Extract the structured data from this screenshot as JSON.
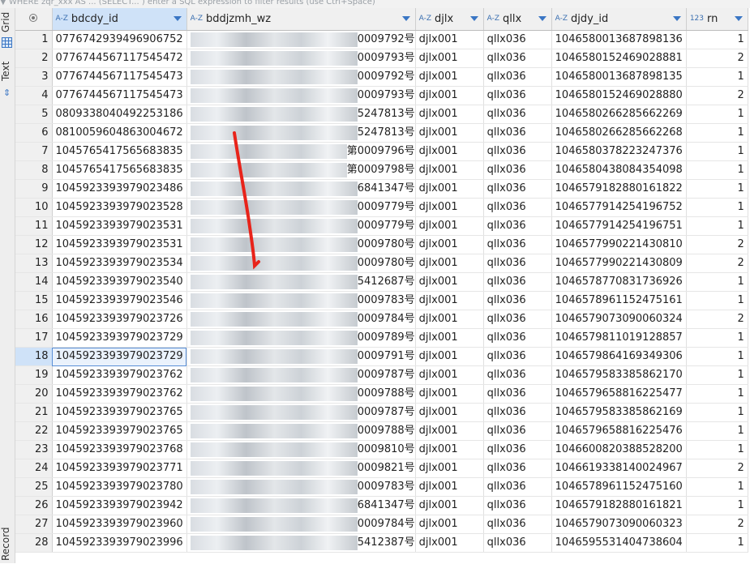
{
  "topbar": {
    "text": "▼ WHERE  zqr_xxx AS ... (SELECT... ) enter a SQL expression to filter results (use Ctrl+Space)"
  },
  "sidebar": {
    "tabs": [
      {
        "label": "Grid"
      },
      {
        "label": "Text"
      },
      {
        "label": "Record"
      }
    ]
  },
  "columns": [
    {
      "name": "bdcdy_id",
      "type_icon": "A-Z"
    },
    {
      "name": "bddjzmh_wz",
      "type_icon": "A-Z"
    },
    {
      "name": "djlx",
      "type_icon": "A-Z"
    },
    {
      "name": "qllx",
      "type_icon": "A-Z"
    },
    {
      "name": "djdy_id",
      "type_icon": "A-Z"
    },
    {
      "name": "rn",
      "type_icon": "123"
    }
  ],
  "rows": [
    {
      "n": "1",
      "bdcdy_id": "0776742939496906752",
      "wz": "0009792号",
      "djlx": "djlx001",
      "qllx": "qllx036",
      "djdy_id": "1046580013687898136",
      "rn": "1"
    },
    {
      "n": "2",
      "bdcdy_id": "0776744567117545472",
      "wz": "0009793号",
      "djlx": "djlx001",
      "qllx": "qllx036",
      "djdy_id": "1046580152469028881",
      "rn": "2"
    },
    {
      "n": "3",
      "bdcdy_id": "0776744567117545473",
      "wz": "0009792号",
      "djlx": "djlx001",
      "qllx": "qllx036",
      "djdy_id": "1046580013687898135",
      "rn": "1"
    },
    {
      "n": "4",
      "bdcdy_id": "0776744567117545473",
      "wz": "0009793号",
      "djlx": "djlx001",
      "qllx": "qllx036",
      "djdy_id": "1046580152469028880",
      "rn": "2"
    },
    {
      "n": "5",
      "bdcdy_id": "0809338040492253186",
      "wz": "5247813号",
      "djlx": "djlx001",
      "qllx": "qllx036",
      "djdy_id": "1046580266285662269",
      "rn": "1"
    },
    {
      "n": "6",
      "bdcdy_id": "0810059604863004672",
      "wz": "5247813号",
      "djlx": "djlx001",
      "qllx": "qllx036",
      "djdy_id": "1046580266285662268",
      "rn": "1"
    },
    {
      "n": "7",
      "bdcdy_id": "1045765417565683835",
      "wz": "第0009796号",
      "djlx": "djlx001",
      "qllx": "qllx036",
      "djdy_id": "1046580378223247376",
      "rn": "1"
    },
    {
      "n": "8",
      "bdcdy_id": "1045765417565683835",
      "wz": "第0009798号",
      "djlx": "djlx001",
      "qllx": "qllx036",
      "djdy_id": "1046580438084354098",
      "rn": "1"
    },
    {
      "n": "9",
      "bdcdy_id": "1045923393979023486",
      "wz": "6841347号",
      "djlx": "djlx001",
      "qllx": "qllx036",
      "djdy_id": "1046579182880161822",
      "rn": "1"
    },
    {
      "n": "10",
      "bdcdy_id": "1045923393979023528",
      "wz": "0009779号",
      "djlx": "djlx001",
      "qllx": "qllx036",
      "djdy_id": "1046577914254196752",
      "rn": "1"
    },
    {
      "n": "11",
      "bdcdy_id": "1045923393979023531",
      "wz": "0009779号",
      "djlx": "djlx001",
      "qllx": "qllx036",
      "djdy_id": "1046577914254196751",
      "rn": "1"
    },
    {
      "n": "12",
      "bdcdy_id": "1045923393979023531",
      "wz": "0009780号",
      "djlx": "djlx001",
      "qllx": "qllx036",
      "djdy_id": "1046577990221430810",
      "rn": "2"
    },
    {
      "n": "13",
      "bdcdy_id": "1045923393979023534",
      "wz": "0009780号",
      "djlx": "djlx001",
      "qllx": "qllx036",
      "djdy_id": "1046577990221430809",
      "rn": "2"
    },
    {
      "n": "14",
      "bdcdy_id": "1045923393979023540",
      "wz": "5412687号",
      "djlx": "djlx001",
      "qllx": "qllx036",
      "djdy_id": "1046578770831736926",
      "rn": "1"
    },
    {
      "n": "15",
      "bdcdy_id": "1045923393979023546",
      "wz": "0009783号",
      "djlx": "djlx001",
      "qllx": "qllx036",
      "djdy_id": "1046578961152475161",
      "rn": "1"
    },
    {
      "n": "16",
      "bdcdy_id": "1045923393979023726",
      "wz": "0009784号",
      "djlx": "djlx001",
      "qllx": "qllx036",
      "djdy_id": "1046579073090060324",
      "rn": "2"
    },
    {
      "n": "17",
      "bdcdy_id": "1045923393979023729",
      "wz": "0009789号",
      "djlx": "djlx001",
      "qllx": "qllx036",
      "djdy_id": "1046579811019128857",
      "rn": "1"
    },
    {
      "n": "18",
      "bdcdy_id": "1045923393979023729",
      "wz": "0009791号",
      "djlx": "djlx001",
      "qllx": "qllx036",
      "djdy_id": "1046579864169349306",
      "rn": "1"
    },
    {
      "n": "19",
      "bdcdy_id": "1045923393979023762",
      "wz": "0009787号",
      "djlx": "djlx001",
      "qllx": "qllx036",
      "djdy_id": "1046579583385862170",
      "rn": "1"
    },
    {
      "n": "20",
      "bdcdy_id": "1045923393979023762",
      "wz": "0009788号",
      "djlx": "djlx001",
      "qllx": "qllx036",
      "djdy_id": "1046579658816225477",
      "rn": "1"
    },
    {
      "n": "21",
      "bdcdy_id": "1045923393979023765",
      "wz": "0009787号",
      "djlx": "djlx001",
      "qllx": "qllx036",
      "djdy_id": "1046579583385862169",
      "rn": "1"
    },
    {
      "n": "22",
      "bdcdy_id": "1045923393979023765",
      "wz": "0009788号",
      "djlx": "djlx001",
      "qllx": "qllx036",
      "djdy_id": "1046579658816225476",
      "rn": "1"
    },
    {
      "n": "23",
      "bdcdy_id": "1045923393979023768",
      "wz": "0009810号",
      "djlx": "djlx001",
      "qllx": "qllx036",
      "djdy_id": "1046600820388528200",
      "rn": "1"
    },
    {
      "n": "24",
      "bdcdy_id": "1045923393979023771",
      "wz": "0009821号",
      "djlx": "djlx001",
      "qllx": "qllx036",
      "djdy_id": "1046619338140024967",
      "rn": "2"
    },
    {
      "n": "25",
      "bdcdy_id": "1045923393979023780",
      "wz": "0009783号",
      "djlx": "djlx001",
      "qllx": "qllx036",
      "djdy_id": "1046578961152475160",
      "rn": "1"
    },
    {
      "n": "26",
      "bdcdy_id": "1045923393979023942",
      "wz": "6841347号",
      "djlx": "djlx001",
      "qllx": "qllx036",
      "djdy_id": "1046579182880161821",
      "rn": "1"
    },
    {
      "n": "27",
      "bdcdy_id": "1045923393979023960",
      "wz": "0009784号",
      "djlx": "djlx001",
      "qllx": "qllx036",
      "djdy_id": "1046579073090060323",
      "rn": "2"
    },
    {
      "n": "28",
      "bdcdy_id": "1045923393979023996",
      "wz": "5412387号",
      "djlx": "djlx001",
      "qllx": "qllx036",
      "djdy_id": "1046595531404738604",
      "rn": "1"
    }
  ],
  "selected_row": "18",
  "colors": {
    "accent": "#3a76c4",
    "selection": "#cfe2f8",
    "annotation": "#e8231a"
  }
}
